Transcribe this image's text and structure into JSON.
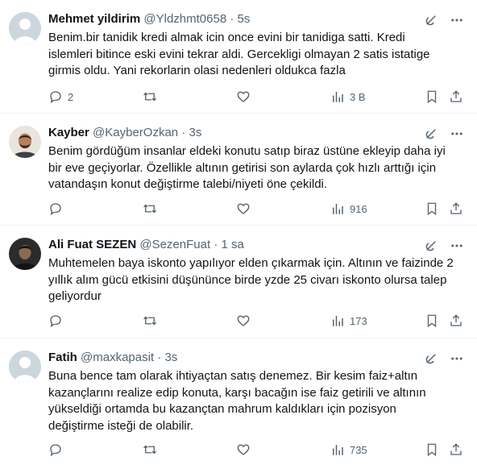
{
  "tweets": [
    {
      "name": "Mehmet yildirim",
      "handle": "@Yldzhmt0658",
      "dot": "·",
      "time": "5s",
      "avatar": "default-avatar",
      "lines": [
        "Benim.bir tanidik kredi almak icin once evini bir tanidiga satti. Kredi",
        "islemleri bitince eski evini tekrar aldi. Gercekligi olmayan 2 satis istatige",
        "girmis oldu. Yani rekorlarin olasi nedenleri oldukca fazla"
      ],
      "replies": "2",
      "retweets": "",
      "likes": "",
      "views": "3 B"
    },
    {
      "name": "Kayber",
      "handle": "@KayberOzkan",
      "dot": "·",
      "time": "3s",
      "avatar": "photo-avatar",
      "lines": [
        "Benim gördüğüm insanlar eldeki konutu satıp biraz üstüne ekleyip daha iyi",
        "bir eve geçiyorlar. Özellikle altının getirisi son aylarda çok hızlı arttığı için",
        "vatandaşın konut değiştirme talebi/niyeti öne çekildi."
      ],
      "replies": "",
      "retweets": "",
      "likes": "",
      "views": "916"
    },
    {
      "name": "Ali Fuat SEZEN",
      "handle": "@SezenFuat",
      "dot": "·",
      "time": "1 sa",
      "avatar": "photo-avatar",
      "lines": [
        "Muhtemelen baya iskonto yapılıyor elden çıkarmak için. Altının ve faizinde 2",
        "yıllık alım gücü etkisini düşününce birde yzde 25 civarı iskonto olursa talep",
        "geliyordur"
      ],
      "replies": "",
      "retweets": "",
      "likes": "",
      "views": "173"
    },
    {
      "name": "Fatih",
      "handle": "@maxkapasit",
      "dot": "·",
      "time": "3s",
      "avatar": "default-avatar",
      "lines": [
        "Buna bence tam olarak ihtiyaçtan satış denemez. Bir kesim faiz+altın",
        "kazançlarını realize edip konuta, karşı bacağın ise faiz getirili ve altının",
        "yükseldiği ortamda bu kazançtan mahrum kaldıkları için pozisyon",
        "değiştirme isteği de olabilir."
      ],
      "replies": "",
      "retweets": "",
      "likes": "",
      "views": "735"
    }
  ]
}
